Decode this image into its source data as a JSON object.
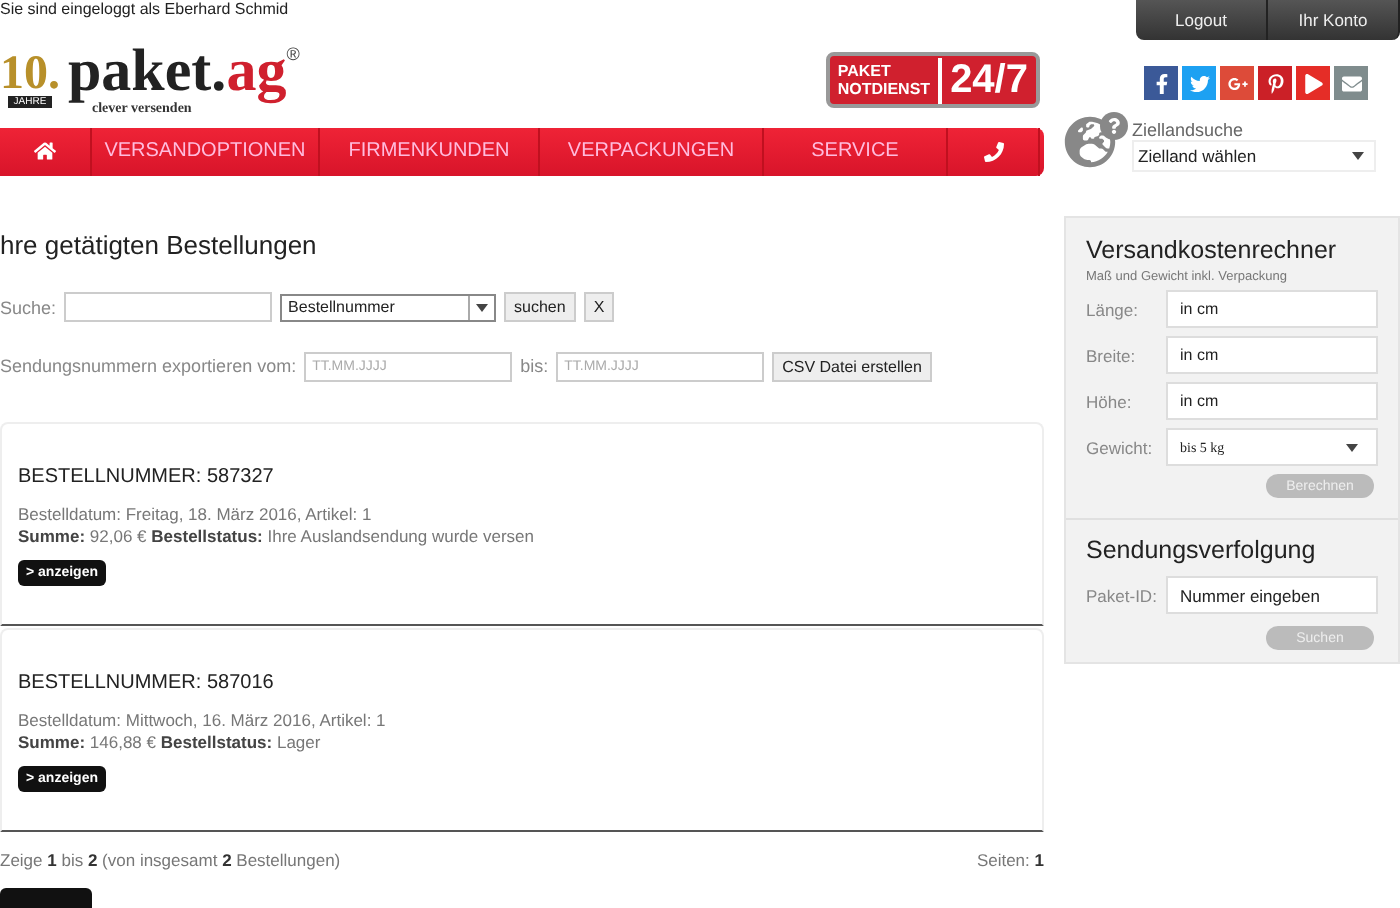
{
  "login_note": "Sie sind eingeloggt als Eberhard Schmid",
  "logo": {
    "anniversary": "10.",
    "anniversary_label": "JAHRE",
    "brand_main": "paket.",
    "brand_accent": "ag",
    "registered": "®",
    "tagline": "clever versenden"
  },
  "emergency_badge": {
    "label_1": "PAKET",
    "label_2": "NOTDIENST",
    "hours": "24/7"
  },
  "account_buttons": [
    "Logout",
    "Ihr Konto"
  ],
  "social": [
    {
      "kind": "facebook",
      "color": "#3b5998"
    },
    {
      "kind": "twitter",
      "color": "#1da1f2"
    },
    {
      "kind": "googleplus",
      "color": "#dd4b39"
    },
    {
      "kind": "pinterest",
      "color": "#cb2027"
    },
    {
      "kind": "youtube",
      "color": "#e52d27"
    },
    {
      "kind": "mail",
      "color": "#7f8c8d"
    }
  ],
  "nav": [
    {
      "kind": "home"
    },
    {
      "kind": "text",
      "label": "VERSANDOPTIONEN"
    },
    {
      "kind": "text",
      "label": "FIRMENKUNDEN"
    },
    {
      "kind": "text",
      "label": "VERPACKUNGEN"
    },
    {
      "kind": "text",
      "label": "SERVICE"
    },
    {
      "kind": "phone"
    }
  ],
  "destination": {
    "label": "Ziellandsuche",
    "value": "Zielland wählen"
  },
  "page_title": "hre getätigten Bestellungen",
  "search": {
    "label": "Suche:",
    "select": "Bestellnummer",
    "button": "suchen",
    "clear": "X"
  },
  "export": {
    "label": "Sendungsnummern exportieren vom:",
    "from_placeholder": "TT.MM.JJJJ",
    "to_label": "bis:",
    "to_placeholder": "TT.MM.JJJJ",
    "button": "CSV Datei erstellen"
  },
  "orders": [
    {
      "number": "BESTELLNUMMER: 587327",
      "date": "Bestelldatum: Freitag, 18. März 2016, Artikel: 1",
      "summary": "**Summe:** 92,06 €  **Bestellstatus:** Ihre Auslandsendung wurde versen",
      "button": "> anzeigen"
    },
    {
      "number": "BESTELLNUMMER: 587016",
      "date": "Bestelldatum: Mittwoch, 16. März 2016, Artikel: 1",
      "summary": "**Summe:** 146,88 €  **Bestellstatus:** Lager",
      "button": "> anzeigen"
    }
  ],
  "pagination": {
    "summary": "Zeige **1** bis **2** (von insgesamt **2** Bestellungen)",
    "pages": "Seiten:  **1**"
  },
  "calculator": {
    "title": "Versandkostenrechner",
    "note": "Maß und Gewicht inkl. Verpackung",
    "fields": [
      {
        "kind": "input",
        "label": "Länge:",
        "value": "in cm"
      },
      {
        "kind": "input",
        "label": "Breite:",
        "value": "in cm"
      },
      {
        "kind": "input",
        "label": "Höhe:",
        "value": "in cm"
      },
      {
        "kind": "select",
        "label": "Gewicht:",
        "value": "bis 5 kg"
      }
    ],
    "button": "Berechnen"
  },
  "tracking": {
    "title": "Sendungsverfolgung",
    "label": "Paket-ID:",
    "placeholder": "Nummer eingeben",
    "button": "Suchen"
  }
}
